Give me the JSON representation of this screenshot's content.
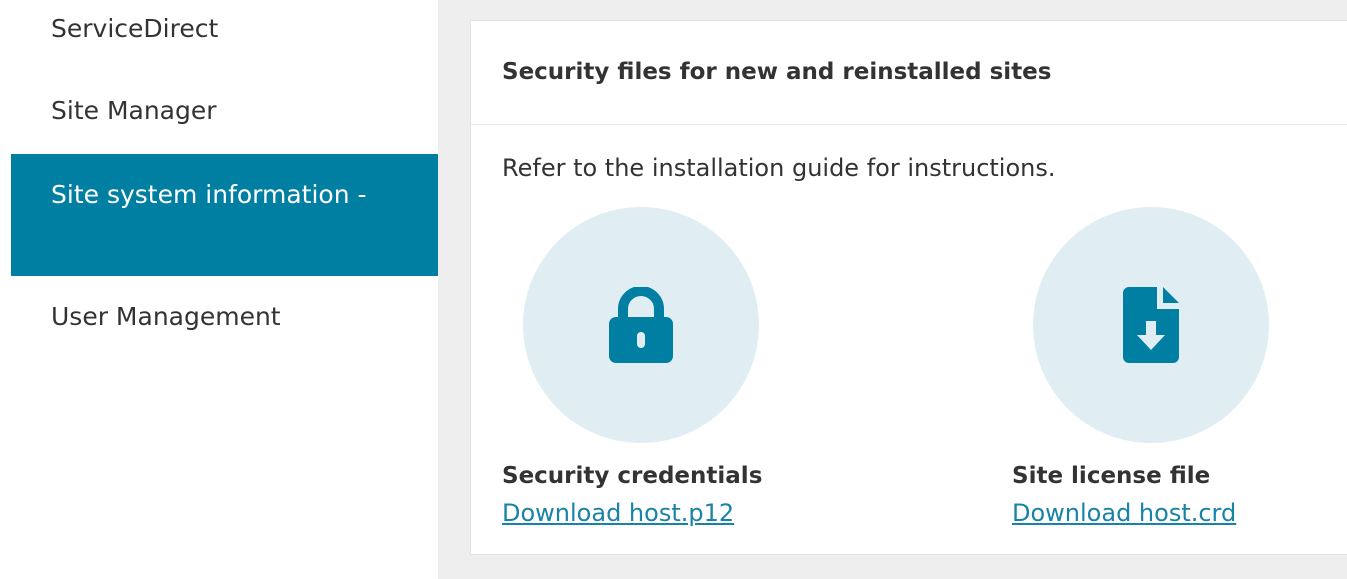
{
  "sidebar": {
    "items": [
      {
        "label": "ServiceDirect"
      },
      {
        "label": "Site Manager"
      },
      {
        "label": "Site system information -",
        "active": true
      },
      {
        "label": "User Management"
      }
    ]
  },
  "panel": {
    "title": "Security files for new and reinstalled sites",
    "description": "Refer to the installation guide for instructions.",
    "files": [
      {
        "title": "Security credentials",
        "link_label": "Download host.p12",
        "icon": "lock-icon"
      },
      {
        "title": "Site license file",
        "link_label": "Download host.crd",
        "icon": "file-download-icon"
      }
    ]
  },
  "colors": {
    "accent": "#007fa3",
    "link": "#1982a8",
    "icon_circle": "#e0eef4",
    "background": "#eeeeee"
  }
}
